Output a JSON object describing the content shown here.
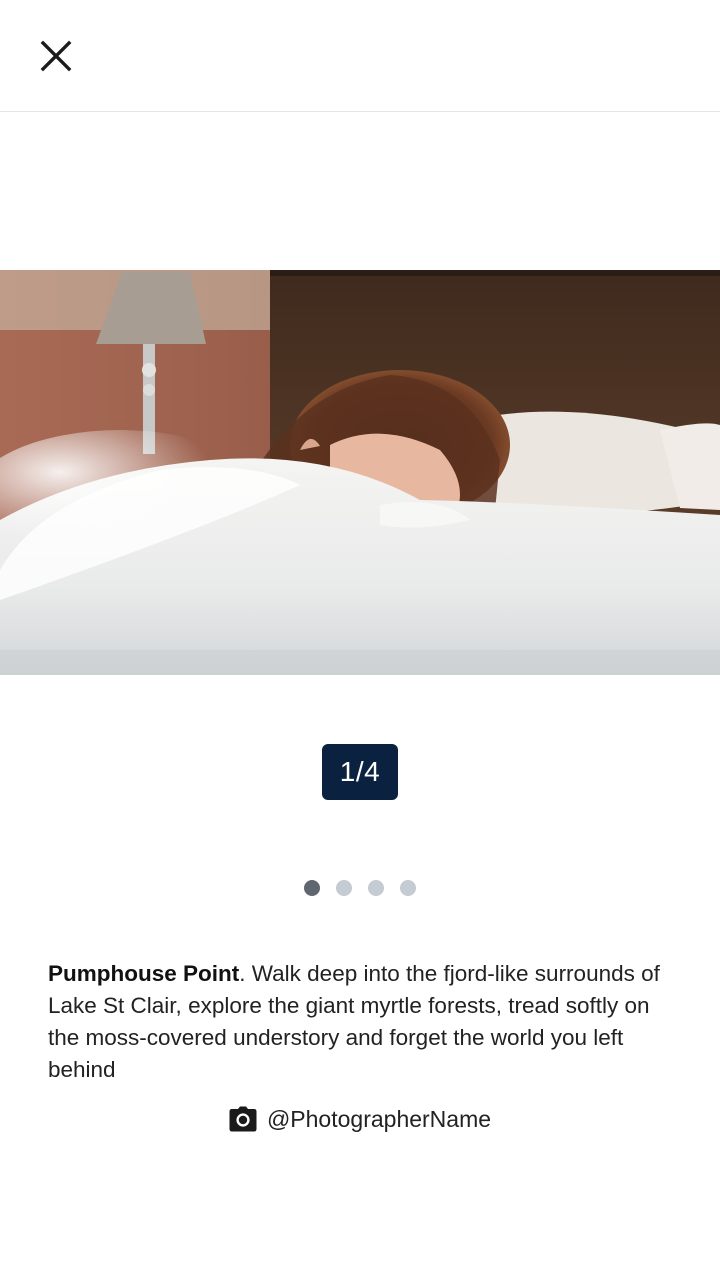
{
  "header": {
    "close_icon": "close-icon"
  },
  "gallery": {
    "image_alt": "Woman lying on a bed with white sheets",
    "counter": "1/4",
    "dots_total": 4,
    "dots_active_index": 0,
    "colors": {
      "counter_bg": "#0a2240",
      "dot_active": "#5f6670",
      "dot_inactive": "#c5cbd3"
    }
  },
  "caption": {
    "title": "Pumphouse Point",
    "body": ". Walk deep into the fjord-like surrounds of Lake St Clair, explore the giant myrtle forests, tread softly on the moss-covered understory and forget the world you left behind"
  },
  "credit": {
    "icon": "camera-icon",
    "handle": "@PhotographerName"
  }
}
